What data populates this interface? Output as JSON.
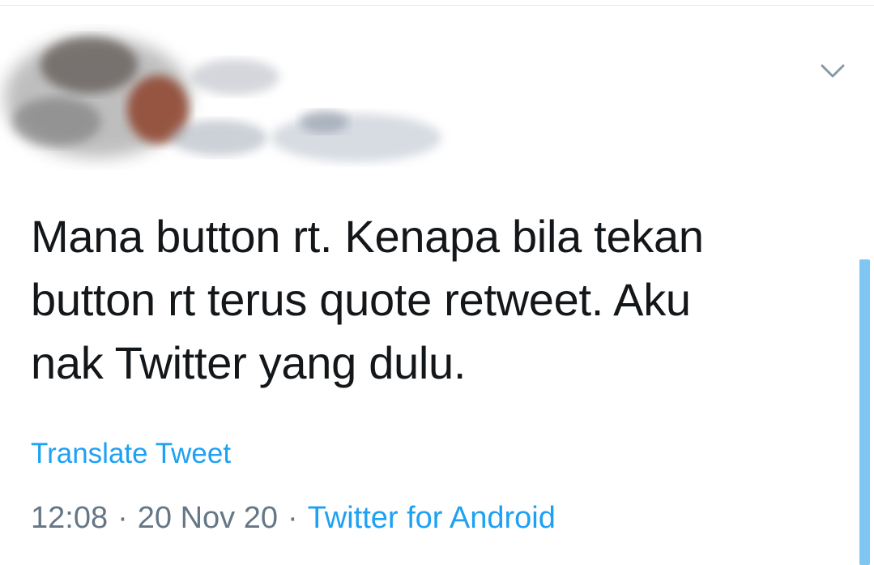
{
  "tweet": {
    "text": "Mana button rt. Kenapa bila tekan\nbutton rt terus quote retweet. Aku\nnak Twitter yang dulu.",
    "translate_label": "Translate Tweet",
    "time": "12:08",
    "date": "20 Nov 20",
    "separator": "·",
    "source": "Twitter for Android"
  },
  "icons": {
    "menu_caret": "chevron-down-icon"
  },
  "colors": {
    "link": "#1da1f2",
    "meta": "#657786",
    "text": "#14171a",
    "scrollbar": "#7fc6f3"
  }
}
